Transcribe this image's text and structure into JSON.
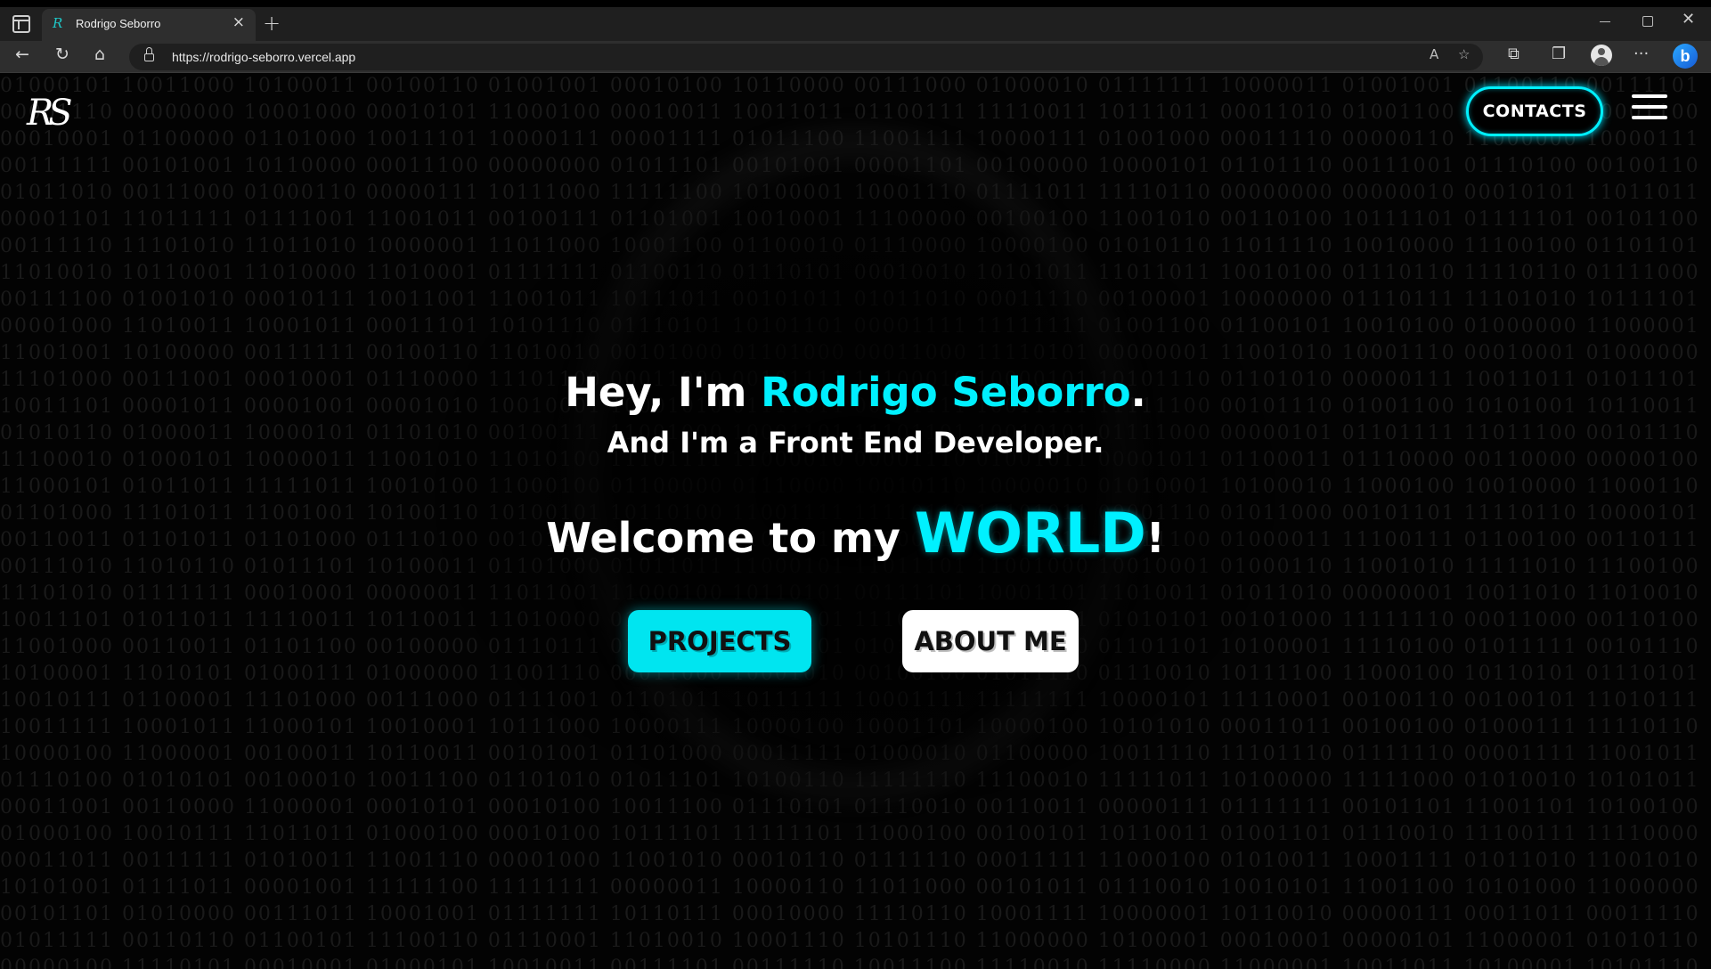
{
  "browser": {
    "tab_title": "Rodrigo Seborro",
    "favicon_text": "R",
    "url": "https://rodrigo-seborro.vercel.app",
    "icons": [
      "sidebar-icon",
      "close-icon",
      "plus-icon",
      "back-icon",
      "refresh-icon",
      "home-icon",
      "lock-icon",
      "read-aloud-icon",
      "favorite-icon",
      "extensions-icon",
      "collections-icon",
      "profile-icon",
      "more-icon",
      "bing-icon"
    ]
  },
  "site": {
    "logo": "RS",
    "contacts_label": "CONTACTS",
    "menu_icon": "hamburger-icon",
    "hero": {
      "greeting_prefix": "Hey, I'm ",
      "name": "Rodrigo Seborro",
      "greeting_suffix": ".",
      "role": "And I'm a Front End Developer.",
      "welcome_prefix": "Welcome to my ",
      "welcome_highlight": "WORLD",
      "welcome_suffix": "!"
    },
    "buttons": {
      "projects": "PROJECTS",
      "about": "ABOUT ME"
    }
  },
  "colors": {
    "accent": "#00f0ff",
    "background": "#000000",
    "text": "#ffffff"
  }
}
